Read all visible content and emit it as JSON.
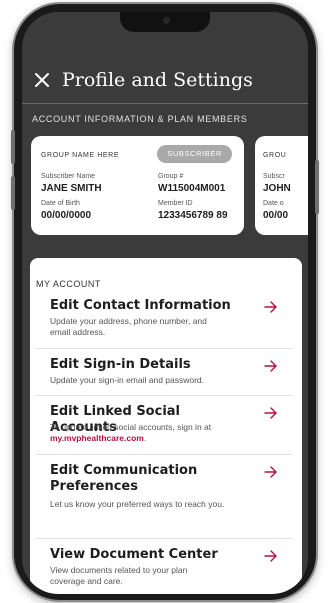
{
  "header": {
    "title": "Profile and Settings"
  },
  "account_section": {
    "label": "ACCOUNT INFORMATION & PLAN MEMBERS"
  },
  "cards": [
    {
      "group_name": "GROUP NAME HERE",
      "badge": "SUBSCRIBER",
      "subscriber_name_label": "Subscriber Name",
      "subscriber_name": "JANE SMITH",
      "group_number_label": "Group #",
      "group_number": "W115004M001",
      "dob_label": "Date of Birth",
      "dob": "00/00/0000",
      "member_id_label": "Member ID",
      "member_id": "1233456789 89"
    },
    {
      "group_name": "GROU",
      "subscriber_name_label": "Subscr",
      "subscriber_name": "JOHN",
      "dob_label": "Date o",
      "dob": "00/00"
    }
  ],
  "my_account": {
    "label": "MY ACCOUNT",
    "items": [
      {
        "title": "Edit Contact Information",
        "desc": "Update your address, phone number, and email address."
      },
      {
        "title": "Edit Sign-in Details",
        "desc": "Update your sign-in email and password."
      },
      {
        "title": "Edit Linked Social Accounts",
        "desc": "To update linked social accounts, sign in at ",
        "link": "my.mvphealthcare.com",
        "desc_suffix": "."
      },
      {
        "title": "Edit Communication Preferences",
        "desc": "Let us know your preferred ways to reach you."
      },
      {
        "title": "View Document Center",
        "desc": "View documents related to your plan coverage and care."
      }
    ]
  },
  "colors": {
    "accent": "#b3123f",
    "header_bg": "#3b3b3b",
    "badge_bg": "#a9a9a9"
  },
  "icons": {
    "close": "close-icon",
    "arrow": "arrow-right-icon"
  }
}
